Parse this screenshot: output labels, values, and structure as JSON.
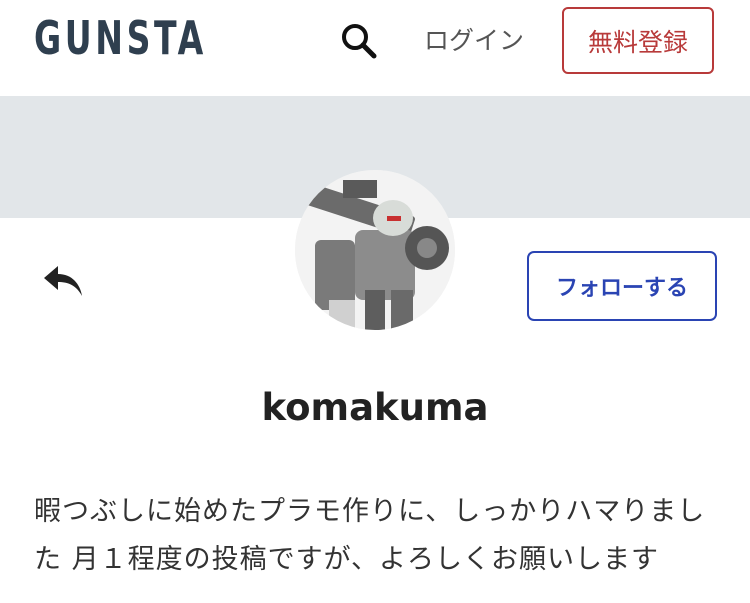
{
  "header": {
    "logo": "GUNSTA",
    "search_icon": "search-icon",
    "login_label": "ログイン",
    "signup_label": "無料登録"
  },
  "profile": {
    "avatar_alt": "avatar",
    "back_icon": "reply-arrow-icon",
    "follow_label": "フォローする",
    "username": "komakuma",
    "bio": "暇つぶしに始めたプラモ作りに、しっかりハマりました 月１程度の投稿ですが、よろしくお願いします"
  },
  "colors": {
    "logo": "#2f3f4f",
    "signup_accent": "#b83a3a",
    "follow_accent": "#2a44b3",
    "cover_bg": "#e2e6e9"
  }
}
